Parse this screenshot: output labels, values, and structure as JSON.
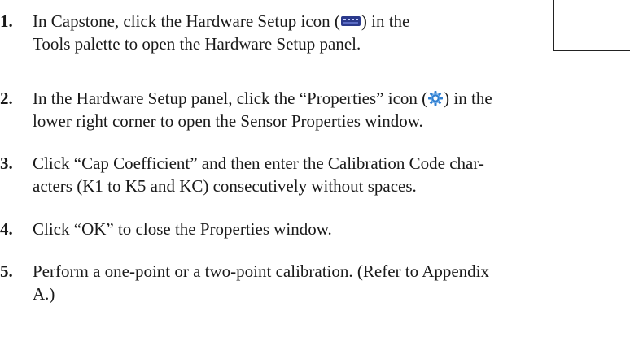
{
  "steps": [
    {
      "number": "1.",
      "line1_before_icon": "In Capstone, click the Hardware Setup icon (",
      "line1_after_icon": ") in the",
      "line2": "Tools palette to open the Hardware Setup panel.",
      "icon": "hardware-setup-icon"
    },
    {
      "number": "2.",
      "line1_before_icon": "In the Hardware Setup panel, click the “Properties” icon (",
      "line1_after_icon": ") in the",
      "line2": "lower right corner to open the Sensor Properties window.",
      "icon": "gear-icon"
    },
    {
      "number": "3.",
      "line1": "Click “Cap Coefficient” and then enter the Calibration Code char-",
      "line2": "acters (K1 to K5 and KC) consecutively without spaces."
    },
    {
      "number": "4.",
      "line1": "Click “OK” to close the Properties window."
    },
    {
      "number": "5.",
      "line1": "Perform a one-point or a two-point calibration. (Refer to Appendix",
      "line2": "A.)"
    }
  ],
  "colors": {
    "text": "#1a1a1a",
    "hardware_icon": "#2b3a8c",
    "gear_icon": "#2f7fd1"
  }
}
